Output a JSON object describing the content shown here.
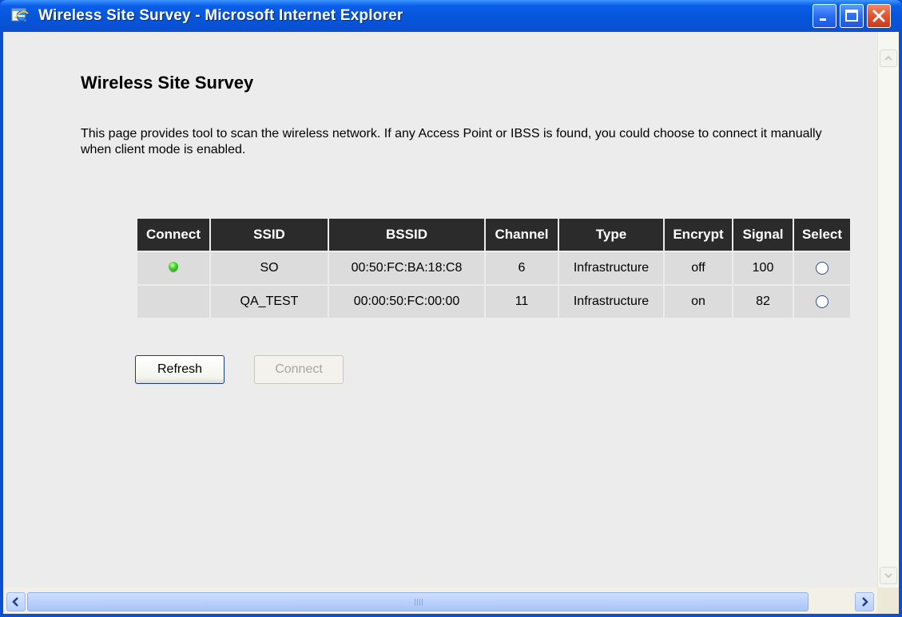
{
  "window": {
    "title": "Wireless Site Survey - Microsoft Internet Explorer",
    "controls": {
      "minimize_icon": "minimize-icon",
      "maximize_icon": "maximize-icon",
      "close_icon": "close-icon"
    }
  },
  "page": {
    "title": "Wireless Site Survey",
    "description": "This page provides tool to scan the wireless network. If any Access Point or IBSS is found, you could choose to connect it manually when client mode is enabled."
  },
  "survey_table": {
    "headers": {
      "connect": "Connect",
      "ssid": "SSID",
      "bssid": "BSSID",
      "channel": "Channel",
      "type": "Type",
      "encrypt": "Encrypt",
      "signal": "Signal",
      "select": "Select"
    },
    "rows": [
      {
        "connected": true,
        "ssid": "SO",
        "bssid": "00:50:FC:BA:18:C8",
        "channel": "6",
        "type": "Infrastructure",
        "encrypt": "off",
        "signal": "100"
      },
      {
        "connected": false,
        "ssid": "QA_TEST",
        "bssid": "00:00:50:FC:00:00",
        "channel": "11",
        "type": "Infrastructure",
        "encrypt": "on",
        "signal": "82"
      }
    ]
  },
  "buttons": {
    "refresh_label": "Refresh",
    "connect_label": "Connect"
  },
  "colors": {
    "title_bar": "#0a5ee8",
    "table_header": "#2b2b2b",
    "table_cell": "#dcdcdc",
    "connected_indicator": "#3fcf2a"
  }
}
